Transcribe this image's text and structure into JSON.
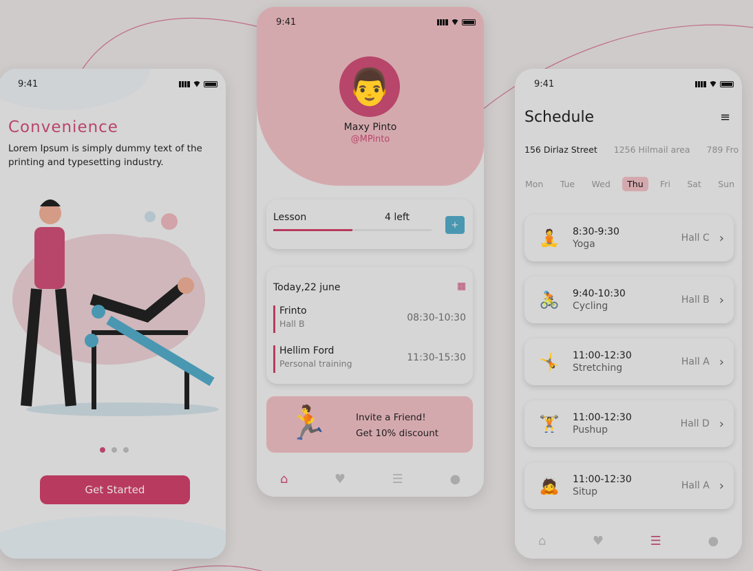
{
  "status_time": "9:41",
  "onboarding": {
    "title": "Convenience",
    "body": "Lorem Ipsum is simply dummy text of the printing and typesetting industry.",
    "page_dots": 3,
    "active_dot": 1,
    "cta": "Get Started"
  },
  "profile": {
    "name": "Maxy Pinto",
    "handle": "@MPinto",
    "lesson": {
      "label": "Lesson",
      "remaining": "4 left",
      "progress": 0.5,
      "add": "+"
    },
    "today": {
      "title": "Today,22 june",
      "items": [
        {
          "name": "Frinto",
          "sub": "Hall B",
          "time": "08:30-10:30"
        },
        {
          "name": "Hellim Ford",
          "sub": "Personal training",
          "time": "11:30-15:30"
        }
      ]
    },
    "invite": {
      "line1": "Invite a Friend!",
      "line2": "Get 10% discount"
    }
  },
  "schedule": {
    "title": "Schedule",
    "locations": [
      "156 Dirlaz Street",
      "1256 Hilmail area",
      "789 Fro"
    ],
    "active_location": 0,
    "days": [
      "Mon",
      "Tue",
      "Wed",
      "Thu",
      "Fri",
      "Sat",
      "Sun"
    ],
    "active_day": 3,
    "classes": [
      {
        "time": "8:30-9:30",
        "name": "Yoga",
        "hall": "Hall C",
        "icon": "🧘"
      },
      {
        "time": "9:40-10:30",
        "name": "Cycling",
        "hall": "Hall B",
        "icon": "🚴"
      },
      {
        "time": "11:00-12:30",
        "name": "Stretching",
        "hall": "Hall A",
        "icon": "🤸"
      },
      {
        "time": "11:00-12:30",
        "name": "Pushup",
        "hall": "Hall D",
        "icon": "🏋"
      },
      {
        "time": "11:00-12:30",
        "name": "Situp",
        "hall": "Hall A",
        "icon": "🙇"
      }
    ]
  },
  "colors": {
    "accent": "#b8456a",
    "header_pink": "#d4a9ae",
    "button_teal": "#4a97b2",
    "background": "#cfcbca"
  }
}
